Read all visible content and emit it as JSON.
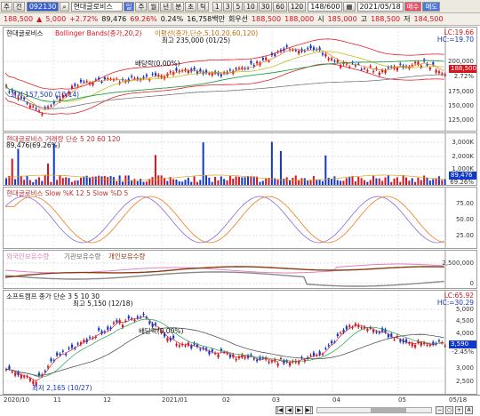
{
  "toolbar": {
    "menu": "주",
    "jeon": "전",
    "code": "092130",
    "tab_active": "일",
    "tabs": [
      "주",
      "월",
      "년",
      "분",
      "초",
      "틱"
    ],
    "periods": [
      "1",
      "3",
      "5",
      "10",
      "30",
      "60",
      "120"
    ],
    "count": "148/600",
    "date": "2021/05/18",
    "buy": "매수",
    "sell": "매도"
  },
  "quote": {
    "price": "188,500",
    "arrow": "▲",
    "change": "5,000",
    "rate": "+2.72%",
    "volume": "89,476",
    "vol_rate": "69.26%",
    "turn": "0.24%",
    "amount": "16,758백만",
    "rot": "회우선",
    "open_lbl": "시",
    "open": "185,000",
    "high_lbl": "고",
    "high": "188,500",
    "low_lbl": "저",
    "low": "184,500",
    "high_shown": "188,500",
    "upper": "188,000"
  },
  "colors": {
    "up": "#d4141e",
    "down": "#1238c8",
    "bb": "#e0202a",
    "ma5": "#f07c18",
    "ma20": "#b8b800",
    "ma60": "#20a048",
    "ma120": "#666666"
  },
  "pane1": {
    "title": "현대글로비스",
    "bb": "Bollinger Bands(종가,20,2)",
    "ma": "이평선(종가,단순,5,10,20,60,120)",
    "high_note": "최고 235,000 (01/25)",
    "low_note": "최저 157,500 (10/14)",
    "div_note": "배당락(0.00%)",
    "lc": "LC:19.66",
    "hc": "HC:=19.70",
    "price_tag": "188,500",
    "pct_tag": "2.72%",
    "ticks": [
      "200,000",
      "175,000",
      "150,000",
      "125,000"
    ]
  },
  "pane2": {
    "title": "현대글로비스 거래량 단순 5 20 60 120",
    "vol_note": "89,476(69.26%)",
    "vol_tag": "89,476",
    "vol_pct": "69.26%",
    "ticks": [
      "3,000K",
      "2,000K",
      "1,000K"
    ]
  },
  "pane3": {
    "title": "현대글로비스 Slow %K 12 5 Slow %D 5",
    "ticks": [
      "75.00",
      "50.00",
      "25.00"
    ]
  },
  "pane4": {
    "l1": "외국인보유수량",
    "l2": "기관보유수량",
    "l3": "개인보유수량",
    "ticks": [
      "2,500,000",
      "0"
    ]
  },
  "pane5": {
    "title": "소프트캠프 종가 단순 3 5 10 30",
    "high_note": "최고 5,150 (12/18)",
    "low_note": "최저 2,165 (10/27)",
    "div_note": "배당락(0.00%)",
    "lc": "LC:65.92",
    "hc": "HC:=30.29",
    "price_tag": "3,590",
    "pct_tag": "-2.45%",
    "ticks": [
      "5,000",
      "4,500",
      "4,000",
      "3,500",
      "3,000",
      "2,500"
    ]
  },
  "xaxis": {
    "labels": [
      "2020/10",
      "11",
      "12",
      "2021/01",
      "02",
      "03",
      "04",
      "05",
      "05/18"
    ]
  }
}
